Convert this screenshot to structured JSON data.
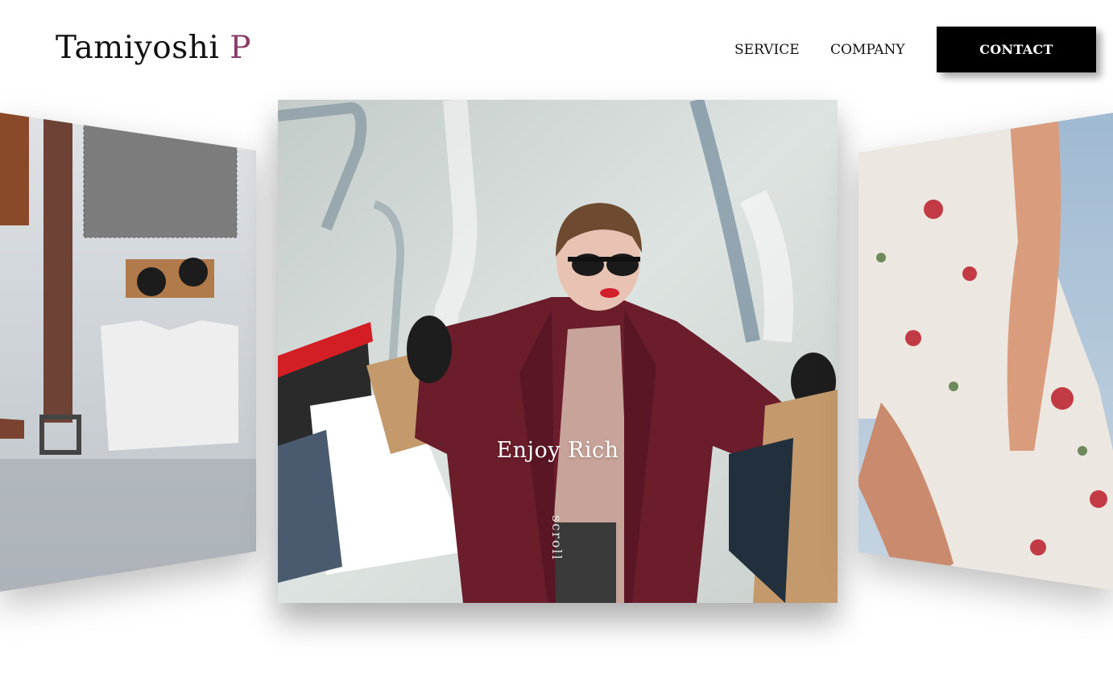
{
  "header": {
    "logo_main": "Tamiyoshi",
    "logo_accent": "P",
    "nav": {
      "service": "SERVICE",
      "company": "COMPANY",
      "contact": "CONTACT"
    }
  },
  "hero": {
    "title": "Enjoy Rich",
    "scroll": "scroll"
  },
  "colors": {
    "accent": "#8a3b6a",
    "button_bg": "#000000",
    "coat": "#6b1d2c"
  }
}
